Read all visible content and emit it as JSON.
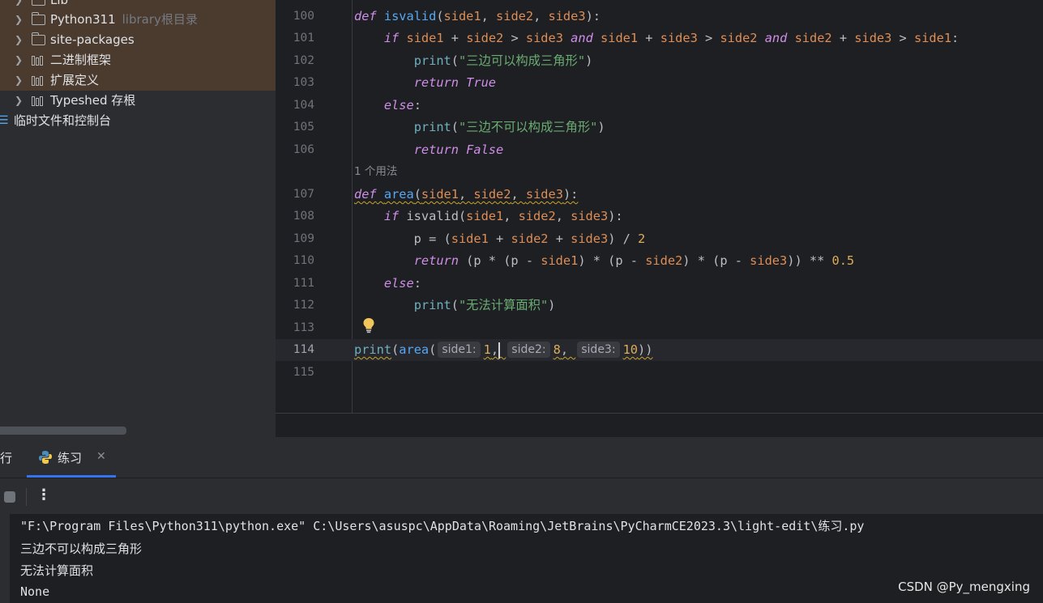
{
  "project_tree": {
    "items": [
      {
        "label": "Lib",
        "sub": "",
        "icon": "folder-icon"
      },
      {
        "label": "Python311",
        "sub": "library根目录",
        "icon": "folder-icon"
      },
      {
        "label": "site-packages",
        "sub": "",
        "icon": "folder-icon"
      },
      {
        "label": "二进制框架",
        "sub": "",
        "icon": "library-icon"
      },
      {
        "label": "扩展定义",
        "sub": "",
        "icon": "library-icon"
      },
      {
        "label": "Typeshed 存根",
        "sub": "",
        "icon": "library-icon"
      }
    ],
    "scratches_label": "临时文件和控制台"
  },
  "editor": {
    "line_numbers": [
      "100",
      "101",
      "102",
      "103",
      "104",
      "105",
      "106",
      "107",
      "108",
      "109",
      "110",
      "111",
      "112",
      "113",
      "114",
      "115"
    ],
    "usage_hint": "1 个用法",
    "strings": {
      "s102": "\"三边可以构成三角形\"",
      "s105": "\"三边不可以构成三角形\"",
      "s112": "\"无法计算面积\""
    },
    "param_hints": [
      "side1:",
      "side2:",
      "side3:"
    ],
    "args": [
      "1",
      "8",
      "10"
    ],
    "constants": [
      "True",
      "False",
      "2",
      "0.5"
    ]
  },
  "run": {
    "tab_cut_label": "行",
    "tab_label": "练习",
    "output": [
      "\"F:\\Program Files\\Python311\\python.exe\" C:\\Users\\asuspc\\AppData\\Roaming\\JetBrains\\PyCharmCE2023.3\\light-edit\\练习.py",
      "三边不可以构成三角形",
      "无法计算面积",
      "None"
    ]
  },
  "watermark": "CSDN @Py_mengxing",
  "colors": {
    "keyword": "#cf8ee8",
    "function": "#56a8f5",
    "string": "#6aab73",
    "param": "#dd8e56",
    "number": "#2aacb8",
    "accent": "#3574f0"
  }
}
